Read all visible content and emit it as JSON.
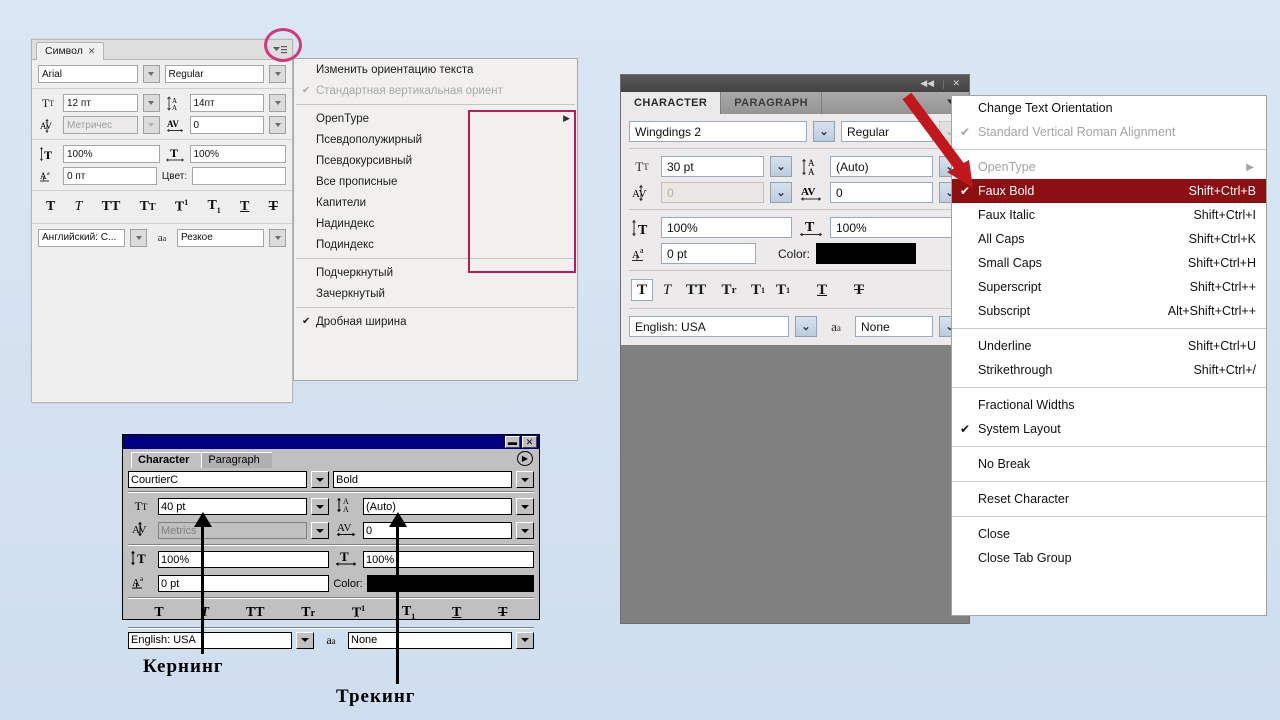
{
  "background_color": "#d5e2f0",
  "panel_ru": {
    "tab_label": "Символ",
    "tab_close": "✕",
    "font_family_value": "Arial",
    "font_style_value": "Regular",
    "size_icon": "font-size-icon",
    "size_value": "12 пт",
    "leading_icon": "leading-icon",
    "leading_value": "14пт",
    "kerning_icon": "kerning-icon",
    "kerning_value": "Метричес",
    "tracking_icon": "tracking-icon",
    "tracking_value": "0",
    "vscale_icon": "vertical-scale-icon",
    "vscale_value": "100%",
    "hscale_icon": "horizontal-scale-icon",
    "hscale_value": "100%",
    "baseline_icon": "baseline-shift-icon",
    "baseline_value": "0 пт",
    "color_label": "Цвет:",
    "color_value": "",
    "style_buttons": [
      "T",
      "T",
      "TT",
      "Tr",
      "T¹",
      "T₁",
      "T",
      "Ŧ"
    ],
    "language_value": "Английский: С...",
    "aa_icon_label": "aa",
    "antialias_value": "Резкое"
  },
  "menu_ru": {
    "items": [
      {
        "label": "Изменить ориентацию текста",
        "checked": false,
        "disabled": false,
        "submenu": false
      },
      {
        "label": "Стандартная вертикальная ориент",
        "checked": true,
        "disabled": true,
        "submenu": false
      },
      {
        "separator": true
      },
      {
        "label": "OpenType",
        "checked": false,
        "disabled": false,
        "submenu": true
      },
      {
        "label": "Псевдополужирный",
        "checked": false,
        "disabled": false,
        "submenu": false
      },
      {
        "label": "Псевдокурсивный",
        "checked": false,
        "disabled": false,
        "submenu": false
      },
      {
        "label": "Все прописные",
        "checked": false,
        "disabled": false,
        "submenu": false
      },
      {
        "label": "Капители",
        "checked": false,
        "disabled": false,
        "submenu": false
      },
      {
        "label": "Надиндекс",
        "checked": false,
        "disabled": false,
        "submenu": false
      },
      {
        "label": "Подиндекс",
        "checked": false,
        "disabled": false,
        "submenu": false
      },
      {
        "separator": true
      },
      {
        "label": "Подчеркнутый",
        "checked": false,
        "disabled": false,
        "submenu": false
      },
      {
        "label": "Зачеркнутый",
        "checked": false,
        "disabled": false,
        "submenu": false
      },
      {
        "separator": true
      },
      {
        "label": "Дробная ширина",
        "checked": true,
        "disabled": false,
        "submenu": false
      }
    ]
  },
  "annotations": {
    "pink_box_color": "#c2185b",
    "pink_circle_color": "#d13a7a",
    "red_arrow_color": "#c1171c",
    "kerning_label": "Кернинг",
    "tracking_label": "Трекинг"
  },
  "panel_classic": {
    "minimize_glyph": "▬",
    "close_glyph": "✕",
    "menu_glyph": "▶",
    "tab_character": "Character",
    "tab_paragraph": "Paragraph",
    "font_family_value": "CourtierC",
    "font_style_value": "Bold",
    "size_value": "40 pt",
    "leading_value": "(Auto)",
    "kerning_value": "Metrics",
    "tracking_value": "0",
    "vscale_value": "100%",
    "hscale_value": "100%",
    "baseline_value": "0 pt",
    "color_label": "Color:",
    "style_buttons": [
      "T",
      "T",
      "TT",
      "Tr",
      "T¹",
      "T₁",
      "T",
      "Ŧ"
    ],
    "language_value": "English: USA",
    "aa_icon_label": "aa",
    "antialias_value": "None"
  },
  "panel_en": {
    "collapse_glyph": "◀◀",
    "close_glyph": "✕",
    "tab_character": "CHARACTER",
    "tab_paragraph": "PARAGRAPH",
    "font_family_value": "Wingdings 2",
    "font_style_value": "Regular",
    "size_value": "30 pt",
    "leading_value": "(Auto)",
    "kerning_value": "0",
    "tracking_value": "0",
    "vscale_value": "100%",
    "hscale_value": "100%",
    "baseline_value": "0 pt",
    "color_label": "Color:",
    "style_buttons": [
      "T",
      "T",
      "TT",
      "Tr",
      "T¹",
      "T₁",
      "T",
      "Ŧ"
    ],
    "language_value": "English: USA",
    "aa_icon_label": "aa",
    "antialias_value": "None"
  },
  "menu_en": {
    "items": [
      {
        "label": "Change Text Orientation",
        "shortcut": "",
        "checked": false,
        "disabled": false,
        "submenu": false,
        "highlighted": false
      },
      {
        "label": "Standard Vertical Roman Alignment",
        "shortcut": "",
        "checked": true,
        "disabled": true,
        "submenu": false,
        "highlighted": false
      },
      {
        "separator": true
      },
      {
        "label": "OpenType",
        "shortcut": "",
        "checked": false,
        "disabled": true,
        "submenu": true,
        "highlighted": false
      },
      {
        "label": "Faux Bold",
        "shortcut": "Shift+Ctrl+B",
        "checked": true,
        "disabled": false,
        "submenu": false,
        "highlighted": true
      },
      {
        "label": "Faux Italic",
        "shortcut": "Shift+Ctrl+I",
        "checked": false,
        "disabled": false,
        "submenu": false,
        "highlighted": false
      },
      {
        "label": "All Caps",
        "shortcut": "Shift+Ctrl+K",
        "checked": false,
        "disabled": false,
        "submenu": false,
        "highlighted": false
      },
      {
        "label": "Small Caps",
        "shortcut": "Shift+Ctrl+H",
        "checked": false,
        "disabled": false,
        "submenu": false,
        "highlighted": false
      },
      {
        "label": "Superscript",
        "shortcut": "Shift+Ctrl++",
        "checked": false,
        "disabled": false,
        "submenu": false,
        "highlighted": false
      },
      {
        "label": "Subscript",
        "shortcut": "Alt+Shift+Ctrl++",
        "checked": false,
        "disabled": false,
        "submenu": false,
        "highlighted": false
      },
      {
        "separator": true
      },
      {
        "label": "Underline",
        "shortcut": "Shift+Ctrl+U",
        "checked": false,
        "disabled": false,
        "submenu": false,
        "highlighted": false
      },
      {
        "label": "Strikethrough",
        "shortcut": "Shift+Ctrl+/",
        "checked": false,
        "disabled": false,
        "submenu": false,
        "highlighted": false
      },
      {
        "separator": true
      },
      {
        "label": "Fractional Widths",
        "shortcut": "",
        "checked": false,
        "disabled": false,
        "submenu": false,
        "highlighted": false
      },
      {
        "label": "System Layout",
        "shortcut": "",
        "checked": true,
        "disabled": false,
        "submenu": false,
        "highlighted": false
      },
      {
        "separator": true
      },
      {
        "label": "No Break",
        "shortcut": "",
        "checked": false,
        "disabled": false,
        "submenu": false,
        "highlighted": false
      },
      {
        "separator": true
      },
      {
        "label": "Reset Character",
        "shortcut": "",
        "checked": false,
        "disabled": false,
        "submenu": false,
        "highlighted": false
      },
      {
        "separator": true
      },
      {
        "label": "Close",
        "shortcut": "",
        "checked": false,
        "disabled": false,
        "submenu": false,
        "highlighted": false
      },
      {
        "label": "Close Tab Group",
        "shortcut": "",
        "checked": false,
        "disabled": false,
        "submenu": false,
        "highlighted": false
      }
    ]
  }
}
